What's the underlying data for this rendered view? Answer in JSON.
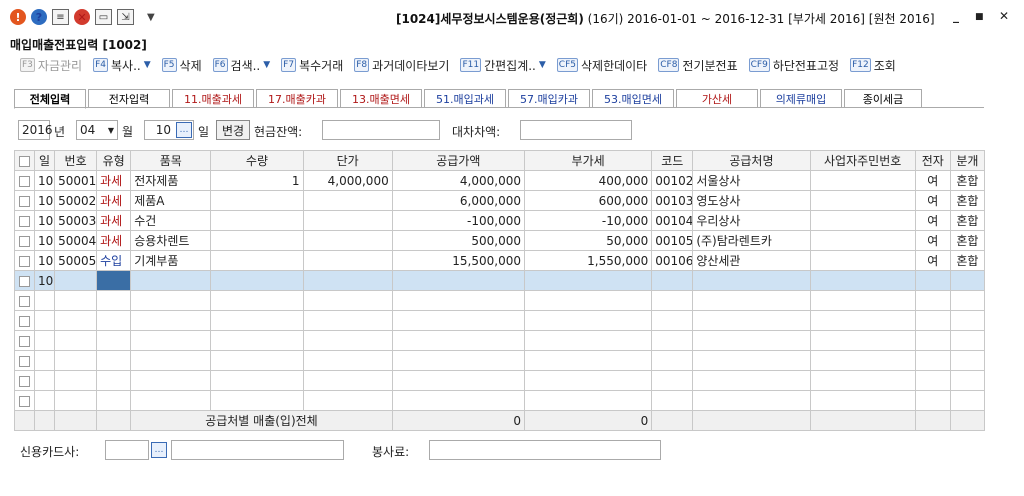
{
  "titlebar": {
    "title_code": "[1024]",
    "title_company": "세무정보시스템운용(정근희)",
    "title_info": "(16기) 2016-01-01 ~ 2016-12-31 [부가세 2016] [원천 2016]",
    "min": "_",
    "max": "■",
    "close": "✕"
  },
  "subtitle": "매입매출전표입력 [1002]",
  "toolbar": [
    {
      "key": "F3",
      "label": "자금관리",
      "disabled": true
    },
    {
      "key": "F4",
      "label": "복사..",
      "dropdown": true
    },
    {
      "key": "F5",
      "label": "삭제"
    },
    {
      "key": "F6",
      "label": "검색..",
      "dropdown": true
    },
    {
      "key": "F7",
      "label": "복수거래"
    },
    {
      "key": "F8",
      "label": "과거데이타보기"
    },
    {
      "key": "F11",
      "label": "간편집계..",
      "dropdown": true
    },
    {
      "key": "CF5",
      "label": "삭제한데이타"
    },
    {
      "key": "CF8",
      "label": "전기분전표"
    },
    {
      "key": "CF9",
      "label": "하단전표고정"
    },
    {
      "key": "F12",
      "label": "조회"
    }
  ],
  "tabs": [
    {
      "label": "전체입력",
      "color": "#000000",
      "active": true
    },
    {
      "label": "전자입력",
      "color": "#000000"
    },
    {
      "label": "11.매출과세",
      "color": "#b01818"
    },
    {
      "label": "17.매출카과",
      "color": "#b01818"
    },
    {
      "label": "13.매출면세",
      "color": "#b01818"
    },
    {
      "label": "51.매입과세",
      "color": "#1d3f9e"
    },
    {
      "label": "57.매입카과",
      "color": "#1d3f9e"
    },
    {
      "label": "53.매입면세",
      "color": "#1d3f9e"
    },
    {
      "label": "가산세",
      "color": "#b01818"
    },
    {
      "label": "의제류매입",
      "color": "#1d3f9e"
    },
    {
      "label": "종이세금",
      "color": "#000000"
    }
  ],
  "daterow": {
    "year": "2016",
    "year_label": "년",
    "month": "04",
    "month_label": "월",
    "day": "10",
    "day_label": "일",
    "change_btn": "변경",
    "cash_label": "현금잔액:",
    "diff_label": "대차차액:"
  },
  "grid": {
    "headers": [
      "일",
      "번호",
      "유형",
      "품목",
      "수량",
      "단가",
      "공급가액",
      "부가세",
      "코드",
      "공급처명",
      "사업자주민번호",
      "전자",
      "분개"
    ],
    "rows": [
      {
        "day": "10",
        "no": "50001",
        "type": "과세",
        "item": "전자제품",
        "qty": "1",
        "price": "4,000,000",
        "supply": "4,000,000",
        "vat": "400,000",
        "code": "00102",
        "vendor": "서울상사",
        "bizno": "",
        "elec": "여",
        "entry": "혼합"
      },
      {
        "day": "10",
        "no": "50002",
        "type": "과세",
        "item": "제품A",
        "qty": "",
        "price": "",
        "supply": "6,000,000",
        "vat": "600,000",
        "code": "00103",
        "vendor": "영도상사",
        "bizno": "",
        "elec": "여",
        "entry": "혼합"
      },
      {
        "day": "10",
        "no": "50003",
        "type": "과세",
        "item": "수건",
        "qty": "",
        "price": "",
        "supply": "-100,000",
        "vat": "-10,000",
        "code": "00104",
        "vendor": "우리상사",
        "bizno": "",
        "elec": "여",
        "entry": "혼합"
      },
      {
        "day": "10",
        "no": "50004",
        "type": "과세",
        "item": "승용차렌트",
        "qty": "",
        "price": "",
        "supply": "500,000",
        "vat": "50,000",
        "code": "00105",
        "vendor": "(주)탐라렌트카",
        "bizno": "",
        "elec": "여",
        "entry": "혼합"
      },
      {
        "day": "10",
        "no": "50005",
        "type": "수입",
        "item": "기계부품",
        "qty": "",
        "price": "",
        "supply": "15,500,000",
        "vat": "1,550,000",
        "code": "00106",
        "vendor": "양산세관",
        "bizno": "",
        "elec": "여",
        "entry": "혼합"
      }
    ],
    "new_row_day": "10",
    "empty_rows": 6,
    "total_label": "공급처별 매출(입)전체",
    "total_supply": "0",
    "total_vat": "0"
  },
  "bottom": {
    "card_label": "신용카드사:",
    "service_label": "봉사료:"
  }
}
